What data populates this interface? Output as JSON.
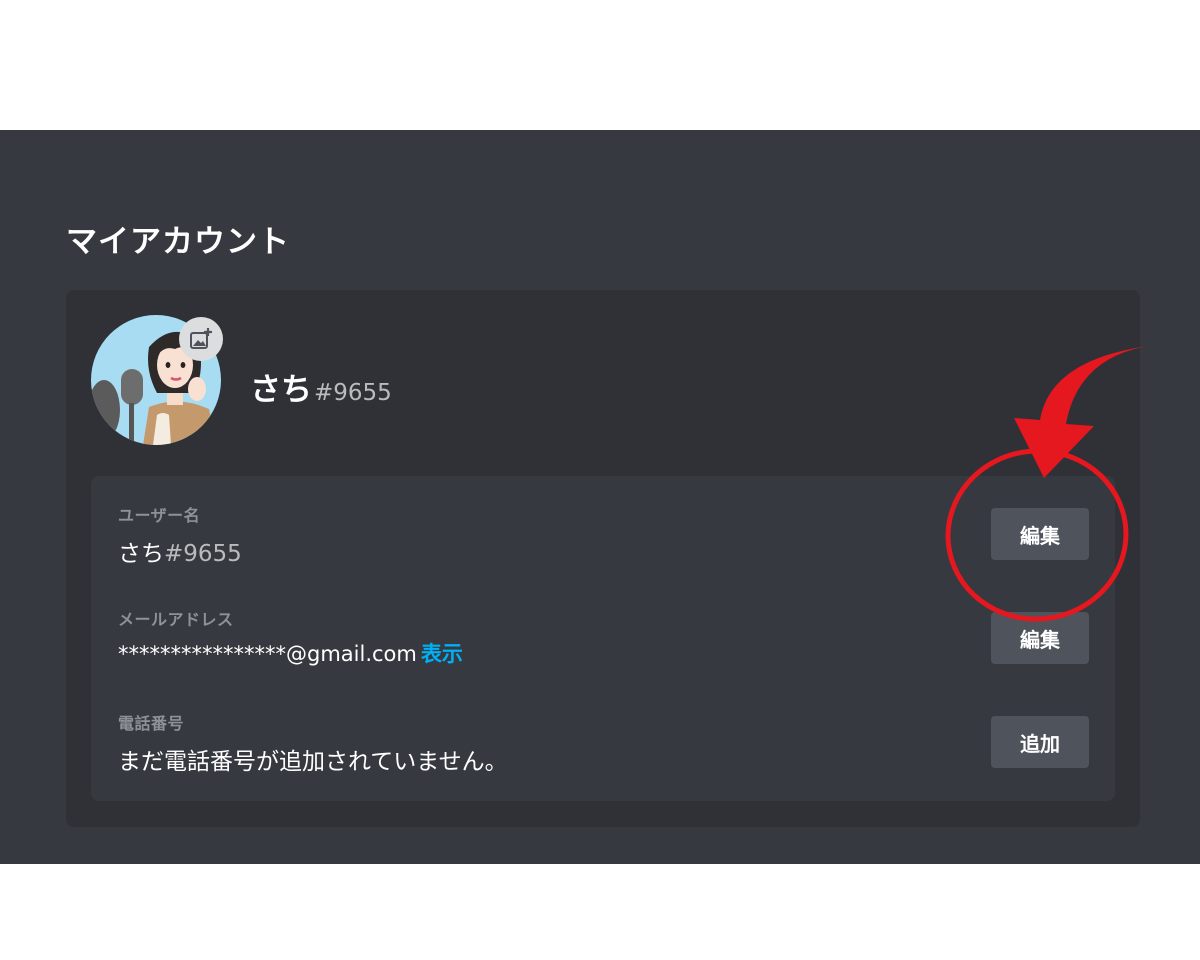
{
  "page": {
    "title": "マイアカウント"
  },
  "profile": {
    "name": "さち",
    "tag": "#9655",
    "avatar_icon": "user-avatar-illustration",
    "upload_icon": "image-plus-icon"
  },
  "fields": {
    "username": {
      "label": "ユーザー名",
      "name": "さち",
      "tag": "#9655",
      "button_label": "編集"
    },
    "email": {
      "label": "メールアドレス",
      "value": "****************@gmail.com",
      "reveal_label": "表示",
      "button_label": "編集"
    },
    "phone": {
      "label": "電話番号",
      "value": "まだ電話番号が追加されていません。",
      "button_label": "追加"
    }
  },
  "colors": {
    "panel_bg": "#36393f",
    "card_bg": "#2f3136",
    "button_bg": "#4f545c",
    "link": "#00b0f4",
    "annotation": "#e5171f"
  }
}
